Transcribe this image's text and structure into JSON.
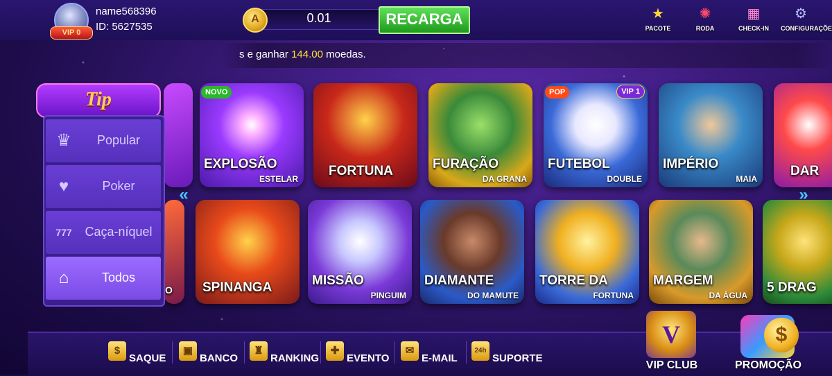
{
  "user": {
    "name": "name568396",
    "id_label": "ID: 5627535",
    "vip_label": "VIP 0"
  },
  "balance": {
    "value": "0.01",
    "recharge_label": "RECARGA"
  },
  "top_menu": [
    {
      "label": "PACOTE",
      "icon": "star-gift-icon",
      "color": "#ffd23a"
    },
    {
      "label": "RODA",
      "icon": "wheel-icon",
      "color": "#ff4a6a"
    },
    {
      "label": "CHECK-IN",
      "icon": "calendar-icon",
      "color": "#ff8ad0"
    },
    {
      "label": "CONFIGURAÇÕES",
      "icon": "gear-icon",
      "color": "#b8c0ff"
    }
  ],
  "ticker": {
    "prefix": "s e ganhar ",
    "amount": "144.00",
    "suffix": "  moedas."
  },
  "sidebar": {
    "logo": "Tip",
    "items": [
      {
        "label": "Popular",
        "icon": "crown-icon",
        "active": false
      },
      {
        "label": "Poker",
        "icon": "cards-icon",
        "active": false
      },
      {
        "label": "Caça-níquel",
        "icon": "slot-777-icon",
        "active": false
      },
      {
        "label": "Todos",
        "icon": "home-bolt-icon",
        "active": true
      }
    ]
  },
  "games_row1": [
    {
      "name": "EXPLOSÃO",
      "sub": "ESTELAR",
      "tag": "NOVO"
    },
    {
      "name": "FORTUNA",
      "sub": ""
    },
    {
      "name": "FURAÇÃO",
      "sub": "DA GRANA"
    },
    {
      "name": "FUTEBOL",
      "sub": "DOUBLE",
      "tag": "POP",
      "tag2": "VIP 1"
    },
    {
      "name": "IMPÉRIO",
      "sub": "MAIA"
    },
    {
      "name": "DAR",
      "sub": ""
    }
  ],
  "games_row2": [
    {
      "name": "SPINANGA",
      "sub": ""
    },
    {
      "name": "MISSÃO",
      "sub": "PINGUIM"
    },
    {
      "name": "DIAMANTE",
      "sub": "DO MAMUTE"
    },
    {
      "name": "TORRE DA",
      "sub": "FORTUNA"
    },
    {
      "name": "MARGEM",
      "sub": "DA ÁGUA"
    },
    {
      "name": "5 DRAG",
      "sub": ""
    }
  ],
  "partial_tile_labels": {
    "row2_left": "O"
  },
  "bottom_menu": [
    {
      "label": "SAQUE",
      "icon": "withdraw-icon"
    },
    {
      "label": "BANCO",
      "icon": "safe-icon"
    },
    {
      "label": "RANKING",
      "icon": "trophy-icon"
    },
    {
      "label": "EVENTO",
      "icon": "gift-icon"
    },
    {
      "label": "E-MAIL",
      "icon": "mail-icon"
    },
    {
      "label": "SUPORTE",
      "icon": "support-24h-icon"
    }
  ],
  "vip_club_label": "VIP CLUB",
  "promo_label": "PROMOÇÃO",
  "colors": {
    "accent_green": "#1e9a1a",
    "ticker_amount": "#ffe03a",
    "sidebar_bg": "#3b1f8e"
  }
}
